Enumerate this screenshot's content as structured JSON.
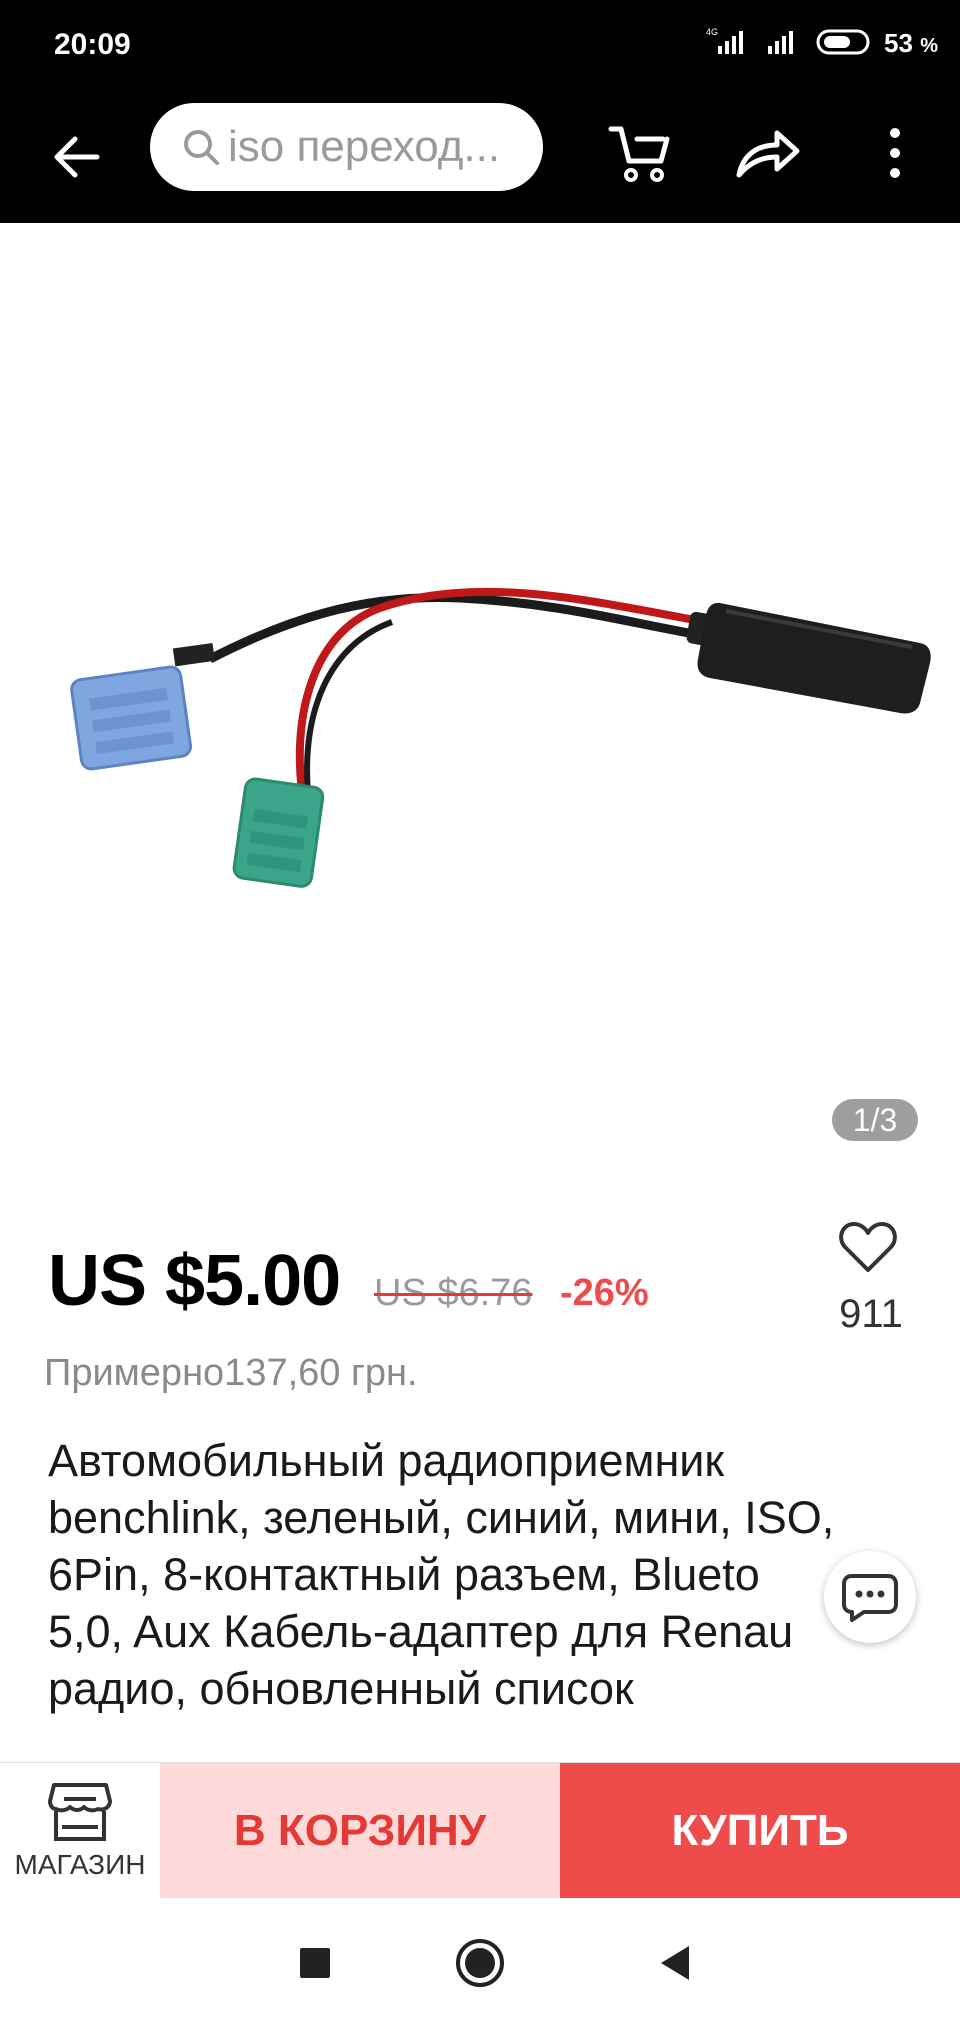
{
  "status_bar": {
    "time": "20:09",
    "network": "4G",
    "battery_percent": "53",
    "battery_unit": "%"
  },
  "header": {
    "search_text": "iso переход..."
  },
  "gallery": {
    "counter": "1/3"
  },
  "product": {
    "price": "US $5.00",
    "old_price": "US $6.76",
    "discount": "-26%",
    "wishlist_count": "911",
    "approx_price": "Примерно137,60 грн.",
    "title_lines": [
      "Автомобильный радиоприемник",
      "benchlink, зеленый, синий, мини, ISO,",
      "6Pin, 8-контактный разъем, Blueto",
      "5,0, Aux Кабель-адаптер для Renau",
      "радио, обновленный список"
    ]
  },
  "actions": {
    "store_label": "МАГАЗИН",
    "cart_label": "В КОРЗИНУ",
    "buy_label": "КУПИТЬ"
  },
  "colors": {
    "accent_red": "#f04b4b",
    "cart_bg": "#ffdada",
    "header_bg": "#000000"
  }
}
